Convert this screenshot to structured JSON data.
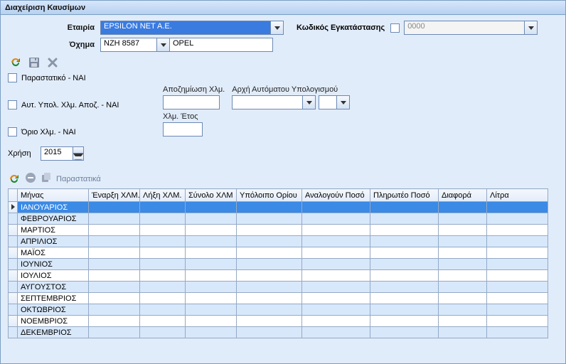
{
  "window_title": "Διαχείριση Καυσίμων",
  "labels": {
    "company": "Εταιρία",
    "install_code": "Κωδικός Εγκατάστασης",
    "vehicle": "Όχημα",
    "voucher_check": "Παραστατικό - ΝΑΙ",
    "auto_calc_check": "Αυτ. Υπολ. Χλμ. Αποζ. - ΝΑΙ",
    "compensation_km": "Αποζημίωση Χλμ.",
    "auto_calc_start": "Αρχή Αυτόματου Υπολογισμού",
    "km_limit_check": "Όριο Χλμ. - ΝΑΙ",
    "km_year": "Χλμ. Έτος",
    "year": "Χρήση",
    "vouchers_btn": "Παραστατικά"
  },
  "values": {
    "company": "EPSILON NET A.E.",
    "install_code": "0000",
    "vehicle_plate": "ΝΖΗ 8587",
    "vehicle_model": "OPEL",
    "compensation_km": "",
    "auto_calc_start_a": "",
    "auto_calc_start_b": "",
    "km_year": "",
    "year": "2015"
  },
  "grid": {
    "headers": [
      "Μήνας",
      "Έναρξη ΧΛΜ.",
      "Λήξη ΧΛΜ.",
      "Σύνολο ΧΛΜ",
      "Υπόλοιπο Ορίου",
      "Αναλογούν Ποσό",
      "Πληρωτέο Ποσό",
      "Διαφορά",
      "Λίτρα"
    ],
    "months": [
      "ΙΑΝΟΥΑΡΙΟΣ",
      "ΦΕΒΡΟΥΑΡΙΟΣ",
      "ΜΑΡΤΙΟΣ",
      "ΑΠΡΙΛΙΟΣ",
      "ΜΑΪΟΣ",
      "ΙΟΥΝΙΟΣ",
      "ΙΟΥΛΙΟΣ",
      "ΑΥΓΟΥΣΤΟΣ",
      "ΣΕΠΤΕΜΒΡΙΟΣ",
      "ΟΚΤΩΒΡΙΟΣ",
      "ΝΟΕΜΒΡΙΟΣ",
      "ΔΕΚΕΜΒΡΙΟΣ"
    ]
  }
}
